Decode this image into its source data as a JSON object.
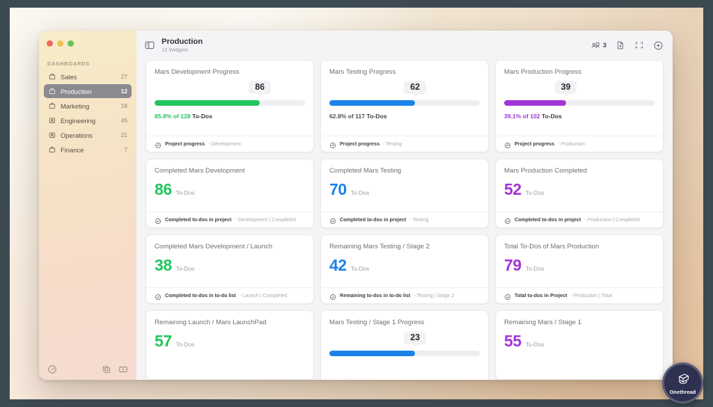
{
  "window": {
    "traffic_lights": [
      "close",
      "minimize",
      "maximize"
    ]
  },
  "sidebar": {
    "section_label": "DASHBOARDS",
    "items": [
      {
        "icon": "briefcase-icon",
        "label": "Sales",
        "count": "27",
        "active": false
      },
      {
        "icon": "briefcase-icon",
        "label": "Production",
        "count": "12",
        "active": true
      },
      {
        "icon": "briefcase-icon",
        "label": "Marketing",
        "count": "18",
        "active": false
      },
      {
        "icon": "person-box-icon",
        "label": "Engineering",
        "count": "45",
        "active": false
      },
      {
        "icon": "person-box-icon",
        "label": "Operations",
        "count": "21",
        "active": false
      },
      {
        "icon": "briefcase-icon",
        "label": "Finance",
        "count": "7",
        "active": false
      }
    ],
    "footer": {
      "help_icon": "help-circle-icon",
      "duplicate_icon": "duplicate-icon",
      "add_icon": "add-box-icon"
    }
  },
  "topbar": {
    "panel_toggle_icon": "panel-layout-icon",
    "title": "Production",
    "subtitle": "12 Widgets",
    "actions": {
      "share_icon": "share-people-icon",
      "share_count": "3",
      "export_icon": "file-export-icon",
      "fullscreen_icon": "fullscreen-icon",
      "add_icon": "add-circle-icon"
    }
  },
  "colors": {
    "green": "#22c55e",
    "blue": "#1b82e8",
    "purple": "#a234d6",
    "gray_text": "#4e4e57",
    "track": "#eeeef1",
    "accent_active": "#8a8a8f"
  },
  "cards": [
    {
      "kind": "progress",
      "title": "Mars Development Progress",
      "bubble_value": "86",
      "bubble_pos_pct": 70,
      "fill_pct": 70,
      "color": "#22c55e",
      "pct_text_color": "#22c55e",
      "pct_value": "85.8% of 128",
      "pct_tail": "To-Dos",
      "footer_icon": "progress-check-icon",
      "footer_main": "Project progress",
      "footer_sub": "- Development"
    },
    {
      "kind": "progress",
      "title": "Mars Testing Progress",
      "bubble_value": "62",
      "bubble_pos_pct": 57,
      "fill_pct": 57,
      "color": "#1b82e8",
      "pct_text_color": "#4e4e57",
      "pct_value": "62.8% of 117",
      "pct_tail": "To-Dos",
      "footer_icon": "progress-check-icon",
      "footer_main": "Project progress",
      "footer_sub": "- Testing"
    },
    {
      "kind": "progress",
      "title": "Mars Production Progress",
      "bubble_value": "39",
      "bubble_pos_pct": 41,
      "fill_pct": 41,
      "color": "#a234d6",
      "pct_text_color": "#a234d6",
      "pct_value": "39.1% of 102",
      "pct_tail": "To-Dos",
      "footer_icon": "progress-check-icon",
      "footer_main": "Project progress",
      "footer_sub": "- Production"
    },
    {
      "kind": "number",
      "title": "Completed Mars Development",
      "value": "86",
      "unit": "To-Dos",
      "color": "#22c55e",
      "footer_icon": "check-circle-icon",
      "footer_main": "Completed to-dos in project",
      "footer_sub": "- Development | Completed"
    },
    {
      "kind": "number",
      "title": "Completed Mars Testing",
      "value": "70",
      "unit": "To-Dos",
      "color": "#1b82e8",
      "footer_icon": "check-circle-icon",
      "footer_main": "Completed to-dos in project",
      "footer_sub": "- Testing"
    },
    {
      "kind": "number",
      "title": "Mars Production Completed",
      "value": "52",
      "unit": "To-Dos",
      "color": "#a234d6",
      "footer_icon": "check-circle-icon",
      "footer_main": "Completed to-dos in project",
      "footer_sub": "- Production | Completed"
    },
    {
      "kind": "number",
      "title": "Completed Mars Development / Launch",
      "value": "38",
      "unit": "To-Dos",
      "color": "#22c55e",
      "footer_icon": "check-circle-icon",
      "footer_main": "Completed to-dos in to-do list",
      "footer_sub": "- Launch | Completed"
    },
    {
      "kind": "number",
      "title": "Remaining Mars Testing / Stage 2",
      "value": "42",
      "unit": "To-Dos",
      "color": "#1b82e8",
      "footer_icon": "check-circle-icon",
      "footer_main": "Remaining to-dos in to-do list",
      "footer_sub": "- Testing | Stage 2"
    },
    {
      "kind": "number",
      "title": "Total To-Dos of Mars Production",
      "value": "79",
      "unit": "To-Dos",
      "color": "#a234d6",
      "footer_icon": "check-circle-icon",
      "footer_main": "Total to-dos in Project",
      "footer_sub": "- Production | Total"
    },
    {
      "kind": "number",
      "title": "Remaining Launch / Mars LaunchPad",
      "value": "57",
      "unit": "To-Dos",
      "color": "#22c55e",
      "footer_icon": "check-circle-icon",
      "footer_main": "",
      "footer_sub": ""
    },
    {
      "kind": "progress",
      "title": "Mars Testing / Stage 1 Progress",
      "bubble_value": "23",
      "bubble_pos_pct": 57,
      "fill_pct": 57,
      "color": "#1b82e8",
      "pct_text_color": "#4e4e57",
      "pct_value": "",
      "pct_tail": "",
      "footer_icon": "progress-check-icon",
      "footer_main": "",
      "footer_sub": ""
    },
    {
      "kind": "number",
      "title": "Remaining Mars / Stage 1",
      "value": "55",
      "unit": "To-Dos",
      "color": "#a234d6",
      "footer_icon": "check-circle-icon",
      "footer_main": "",
      "footer_sub": ""
    }
  ],
  "branding": {
    "badge_label": "Onethread",
    "badge_icon": "onethread-logo-icon"
  }
}
